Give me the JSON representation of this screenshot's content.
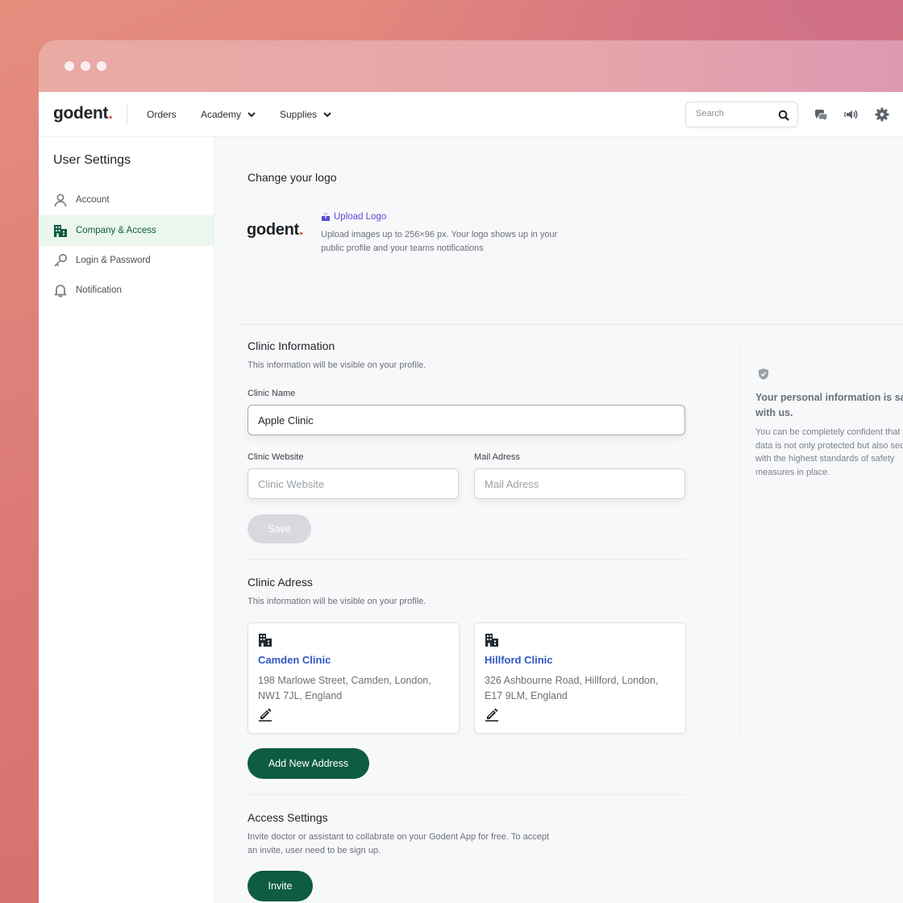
{
  "brand": {
    "name": "godent",
    "dot": ".",
    "accent_color": "#e2543e"
  },
  "nav": {
    "links": [
      {
        "label": "Orders",
        "has_dropdown": false
      },
      {
        "label": "Academy",
        "has_dropdown": true
      },
      {
        "label": "Supplies",
        "has_dropdown": true
      }
    ],
    "search_placeholder": "Search",
    "icons": [
      "search-icon",
      "chat-icon",
      "speaker-icon",
      "gear-icon"
    ]
  },
  "sidebar": {
    "title": "User Settings",
    "items": [
      {
        "label": "Account",
        "icon": "user-icon",
        "active": false
      },
      {
        "label": "Company & Access",
        "icon": "building-icon",
        "active": true
      },
      {
        "label": "Login & Password",
        "icon": "key-icon",
        "active": false
      },
      {
        "label": "Notification",
        "icon": "bell-icon",
        "active": false
      }
    ]
  },
  "logo_section": {
    "title": "Change your logo",
    "upload_label": "Upload Logo",
    "hint": "Upload images up to 256×96 px. Your logo shows up in your public profile and your teams notifications"
  },
  "clinic_info": {
    "title": "Clinic Information",
    "subtitle": "This information will be visible on your profile.",
    "name_label": "Clinic Name",
    "name_value": "Apple Clinic",
    "website_label": "Clinic Website",
    "website_placeholder": "Clinic Website",
    "mail_label": "Mail Adress",
    "mail_placeholder": "Mail Adress",
    "save_label": "Save"
  },
  "clinic_address": {
    "title": "Clinic Adress",
    "subtitle": "This information will be visible on your profile.",
    "cards": [
      {
        "name": "Camden Clinic",
        "address": "198 Marlowe Street, Camden, London, NW1 7JL, England"
      },
      {
        "name": "Hillford Clinic",
        "address": "326 Ashbourne Road, Hillford, London, E17 9LM, England"
      }
    ],
    "add_label": "Add New Address"
  },
  "access": {
    "title": "Access Settings",
    "subtitle": "Invite doctor or assistant to collabrate on your Godent App for free. To accept an invite, user need to be sign up.",
    "invite_label": "Invite"
  },
  "info_panel": {
    "icon": "shield-icon",
    "title": "Your personal information is safe with us.",
    "body": "You can be completely confident that your data is not only protected but also secured with the highest standards of safety measures in place."
  },
  "colors": {
    "primary": "#0e5c42",
    "link": "#2f57c4",
    "upload": "#5b4bd6",
    "active_bg": "#eaf6ee"
  }
}
